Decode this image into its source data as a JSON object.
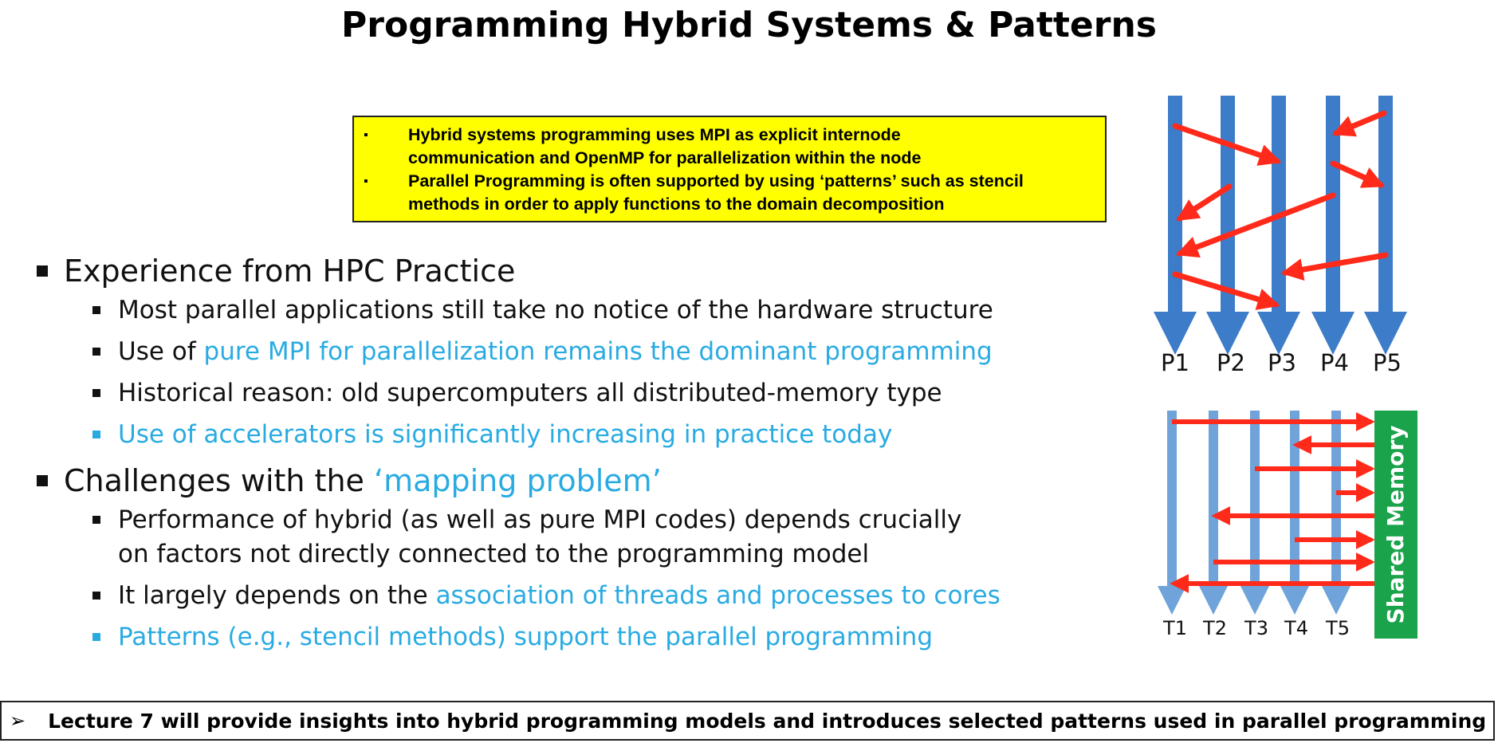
{
  "slide": {
    "title": "Programming Hybrid Systems & Patterns",
    "yellow_box": [
      {
        "line1": "Hybrid systems programming uses MPI as explicit internode",
        "line2": "communication and OpenMP for parallelization within the node"
      },
      {
        "line1": "Parallel Programming is often supported by using ‘patterns’ such as stencil",
        "line2": "methods in order to apply functions to the domain decomposition"
      }
    ],
    "section1": {
      "heading": "Experience from HPC Practice",
      "items": [
        {
          "plain": "Most parallel applications still take no notice of the hardware structure",
          "highlight": ""
        },
        {
          "plain": "Use of ",
          "highlight": "pure MPI for parallelization remains the dominant programming"
        },
        {
          "plain": "Historical reason: old supercomputers all distributed-memory type",
          "highlight": ""
        },
        {
          "plain": "",
          "highlight": "Use of accelerators is significantly increasing in practice today"
        }
      ]
    },
    "section2": {
      "heading_plain": "Challenges with the ",
      "heading_highlight": "‘mapping problem’",
      "items": [
        {
          "line1": "Performance of hybrid (as well as pure MPI codes) depends crucially",
          "line2": "on factors not directly connected to the programming model"
        },
        {
          "plain": "It largely depends on the ",
          "highlight": "association of threads and processes to cores"
        },
        {
          "highlight": "Patterns (e.g., stencil methods) support the parallel programming"
        }
      ]
    },
    "footer": {
      "arrow": "➢",
      "text": "Lecture 7 will provide insights into hybrid programming models and introduces selected patterns used in parallel programming"
    }
  },
  "diagram_top": {
    "process_labels": [
      "P1",
      "P2",
      "P3",
      "P4",
      "P5"
    ],
    "line_color": "#3d7cc9",
    "arrow_color": "#ff2a1a"
  },
  "diagram_bottom": {
    "thread_labels": [
      "T1",
      "T2",
      "T3",
      "T4",
      "T5"
    ],
    "shared_memory_label": "Shared Memory",
    "line_color": "#6fa3d9",
    "memory_color": "#1aa34a",
    "arrow_color": "#ff2a1a"
  }
}
